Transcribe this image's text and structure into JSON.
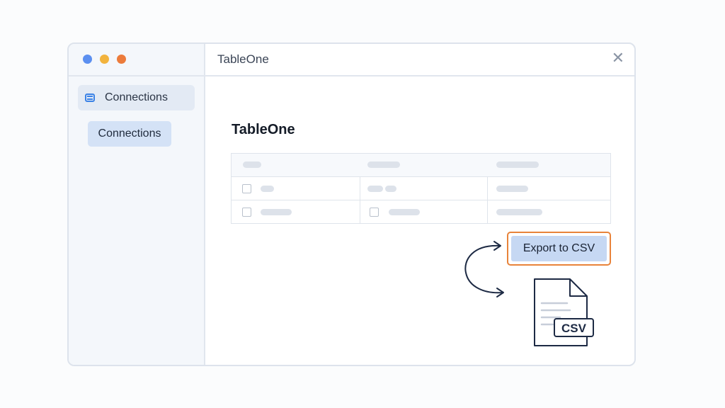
{
  "window": {
    "title": "TableOne",
    "close_symbol": "✕"
  },
  "sidebar": {
    "items": [
      {
        "label": "Connections",
        "icon": "database-icon"
      }
    ],
    "subitems": [
      {
        "label": "Connections"
      }
    ]
  },
  "main": {
    "title": "TableOne",
    "table": {
      "columns": 3,
      "rows": 2
    },
    "export_button": {
      "label": "Export to CSV"
    },
    "file_badge": "CSV"
  },
  "colors": {
    "dot_blue": "#5b8ff0",
    "dot_yellow": "#f2b33d",
    "dot_orange": "#ec7b3b",
    "accent": "#3b82e6",
    "highlight": "#e8833a",
    "button_fill": "#c6d8f3"
  }
}
